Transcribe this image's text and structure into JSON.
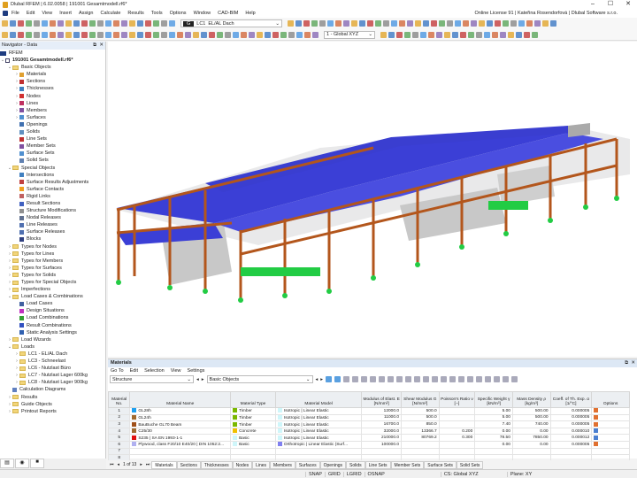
{
  "title": "Dlubal RFEM | 6.02.0058 | 191001 Gesamtmodell.rf6*",
  "menu": [
    "File",
    "Edit",
    "View",
    "Insert",
    "Assign",
    "Calculate",
    "Results",
    "Tools",
    "Options",
    "Window",
    "CAD-BIM",
    "Help"
  ],
  "license": "Online License 91 | Kateřina Rosendorfová | Dlubal Software s.r.o.",
  "toolbar": {
    "lc_badge": "G",
    "lc_id": "LC1",
    "lc_name": "EL/AL Dach",
    "cs": "1 - Global XYZ"
  },
  "navigator": {
    "title": "Navigator - Data",
    "root": "RFEM",
    "model": "191001 Gesamtmodell.rf6*",
    "items": [
      {
        "label": "Basic Objects",
        "level": 1,
        "folder": true,
        "open": true
      },
      {
        "label": "Materials",
        "level": 2,
        "color": "#e0a030"
      },
      {
        "label": "Sections",
        "level": 2,
        "color": "#c03030"
      },
      {
        "label": "Thicknesses",
        "level": 2,
        "color": "#4080c0"
      },
      {
        "label": "Nodes",
        "level": 2,
        "color": "#d03030"
      },
      {
        "label": "Lines",
        "level": 2,
        "color": "#c03060"
      },
      {
        "label": "Members",
        "level": 2,
        "color": "#8050a0"
      },
      {
        "label": "Surfaces",
        "level": 2,
        "color": "#5090d0"
      },
      {
        "label": "Openings",
        "level": 2,
        "color": "#4070b0"
      },
      {
        "label": "Solids",
        "level": 2,
        "color": "#6090c0"
      },
      {
        "label": "Line Sets",
        "level": 2,
        "color": "#c03030"
      },
      {
        "label": "Member Sets",
        "level": 2,
        "color": "#8050a0"
      },
      {
        "label": "Surface Sets",
        "level": 2,
        "color": "#5090d0"
      },
      {
        "label": "Solid Sets",
        "level": 2,
        "color": "#6080b0"
      },
      {
        "label": "Special Objects",
        "level": 1,
        "folder": true,
        "open": true
      },
      {
        "label": "Intersections",
        "level": 2,
        "color": "#4080c0"
      },
      {
        "label": "Surface Results Adjustments",
        "level": 2,
        "color": "#c04040"
      },
      {
        "label": "Surface Contacts",
        "level": 2,
        "color": "#f0a020"
      },
      {
        "label": "Rigid Links",
        "level": 2,
        "color": "#c06060"
      },
      {
        "label": "Result Sections",
        "level": 2,
        "color": "#4060c0"
      },
      {
        "label": "Structure Modifications",
        "level": 2,
        "color": "#909090"
      },
      {
        "label": "Nodal Releases",
        "level": 2,
        "color": "#607090"
      },
      {
        "label": "Line Releases",
        "level": 2,
        "color": "#5070b0"
      },
      {
        "label": "Surface Releases",
        "level": 2,
        "color": "#5070b0"
      },
      {
        "label": "Blocks",
        "level": 2,
        "color": "#304080"
      },
      {
        "label": "Types for Nodes",
        "level": 1,
        "folder": true
      },
      {
        "label": "Types for Lines",
        "level": 1,
        "folder": true
      },
      {
        "label": "Types for Members",
        "level": 1,
        "folder": true
      },
      {
        "label": "Types for Surfaces",
        "level": 1,
        "folder": true
      },
      {
        "label": "Types for Solids",
        "level": 1,
        "folder": true
      },
      {
        "label": "Types for Special Objects",
        "level": 1,
        "folder": true
      },
      {
        "label": "Imperfections",
        "level": 1,
        "folder": true
      },
      {
        "label": "Load Cases & Combinations",
        "level": 1,
        "folder": true,
        "open": true
      },
      {
        "label": "Load Cases",
        "level": 2,
        "color": "#4060a0"
      },
      {
        "label": "Design Situations",
        "level": 2,
        "color": "#c030c0"
      },
      {
        "label": "Load Combinations",
        "level": 2,
        "color": "#30a030"
      },
      {
        "label": "Result Combinations",
        "level": 2,
        "color": "#3050c0"
      },
      {
        "label": "Static Analysis Settings",
        "level": 2,
        "color": "#3060b0"
      },
      {
        "label": "Load Wizards",
        "level": 1,
        "folder": true
      },
      {
        "label": "Loads",
        "level": 1,
        "folder": true,
        "open": true
      },
      {
        "label": "LC1 - EL/AL Dach",
        "level": 2,
        "folder": true
      },
      {
        "label": "LC3 - Schneelast",
        "level": 2,
        "folder": true
      },
      {
        "label": "LC6 - Nutzlast Büro",
        "level": 2,
        "folder": true
      },
      {
        "label": "LC7 - Nutzlast Lager 600kg",
        "level": 2,
        "folder": true
      },
      {
        "label": "LC8 - Nutzlast Lager 900kg",
        "level": 2,
        "folder": true
      },
      {
        "label": "Calculation Diagrams",
        "level": 1,
        "color": "#6080c0"
      },
      {
        "label": "Results",
        "level": 1,
        "folder": true
      },
      {
        "label": "Guide Objects",
        "level": 1,
        "folder": true
      },
      {
        "label": "Printout Reports",
        "level": 1,
        "folder": true
      }
    ]
  },
  "materials": {
    "title": "Materials",
    "menu": [
      "Go To",
      "Edit",
      "Selection",
      "View",
      "Settings"
    ],
    "filter1": "Structure",
    "filter2": "Basic Objects",
    "columns": [
      "Material No.",
      "Material Name",
      "Material Type",
      "Material Model",
      "Modulus of Elast. E [N/mm²]",
      "Shear Modulus G [N/mm²]",
      "Poisson's Ratio ν [--]",
      "Specific Weight γ [kN/m³]",
      "Mass Density ρ [kg/m³]",
      "Coeff. of Th. Exp. α [1/°C]",
      "Options"
    ],
    "rows": [
      {
        "no": "1",
        "name": "GL28h",
        "name_color": "#1ea0f0",
        "type": "Timber",
        "type_color": "#7ab800",
        "model": "Isotropic | Linear Elastic",
        "model_color": "#cff6fa",
        "E": "12000.0",
        "G": "500.0",
        "nu": "",
        "gamma": "5.00",
        "rho": "500.00",
        "alpha": "0.000005"
      },
      {
        "no": "2",
        "name": "GL24h",
        "name_color": "#a06a30",
        "type": "Timber",
        "type_color": "#7ab800",
        "model": "Isotropic | Linear Elastic",
        "model_color": "#cff6fa",
        "E": "11000.0",
        "G": "500.0",
        "nu": "",
        "gamma": "5.00",
        "rho": "500.00",
        "alpha": "0.000005"
      },
      {
        "no": "3",
        "name": "BauBuche GL70 Beam",
        "name_color": "#a0501a",
        "type": "Timber",
        "type_color": "#7ab800",
        "model": "Isotropic | Linear Elastic",
        "model_color": "#cff6fa",
        "E": "16700.0",
        "G": "850.0",
        "nu": "",
        "gamma": "7.40",
        "rho": "740.00",
        "alpha": "0.000005"
      },
      {
        "no": "4",
        "name": "C25/30",
        "name_color": "#a06a30",
        "type": "Concrete",
        "type_color": "#f0c000",
        "model": "Isotropic | Linear Elastic",
        "model_color": "#cff6fa",
        "E": "32000.0",
        "G": "13366.7",
        "nu": "0.200",
        "gamma": "0.00",
        "rho": "0.00",
        "alpha": "0.000010"
      },
      {
        "no": "5",
        "name": "S235 | SA EN 1993-1-1",
        "name_color": "#e01010",
        "type": "Basic",
        "type_color": "#cff6fa",
        "model": "Isotropic | Linear Elastic",
        "model_color": "#cff6fa",
        "E": "210000.0",
        "G": "80769.2",
        "nu": "0.300",
        "gamma": "78.50",
        "rho": "7850.00",
        "alpha": "0.000012"
      },
      {
        "no": "6",
        "name": "Plywood, class F20/10 E40/20 | DIN 1052:2...",
        "name_color": "#b0b0f0",
        "type": "Basic",
        "type_color": "#cff6fa",
        "model": "Orthotropic | Linear Elastic (Surf...",
        "model_color": "#8080f0",
        "E": "100000.0",
        "G": "",
        "nu": "",
        "gamma": "0.00",
        "rho": "0.00",
        "alpha": "0.000005"
      },
      {
        "no": "7"
      },
      {
        "no": "8"
      }
    ],
    "pager": "1 of 13",
    "tabs": [
      "Materials",
      "Sections",
      "Thicknesses",
      "Nodes",
      "Lines",
      "Members",
      "Surfaces",
      "Openings",
      "Solids",
      "Line Sets",
      "Member Sets",
      "Surface Sets",
      "Solid Sets"
    ]
  },
  "status": [
    "SNAP",
    "GRID",
    "LGRID",
    "OSNAP",
    "CS: Global XYZ",
    "Plane: XY"
  ]
}
